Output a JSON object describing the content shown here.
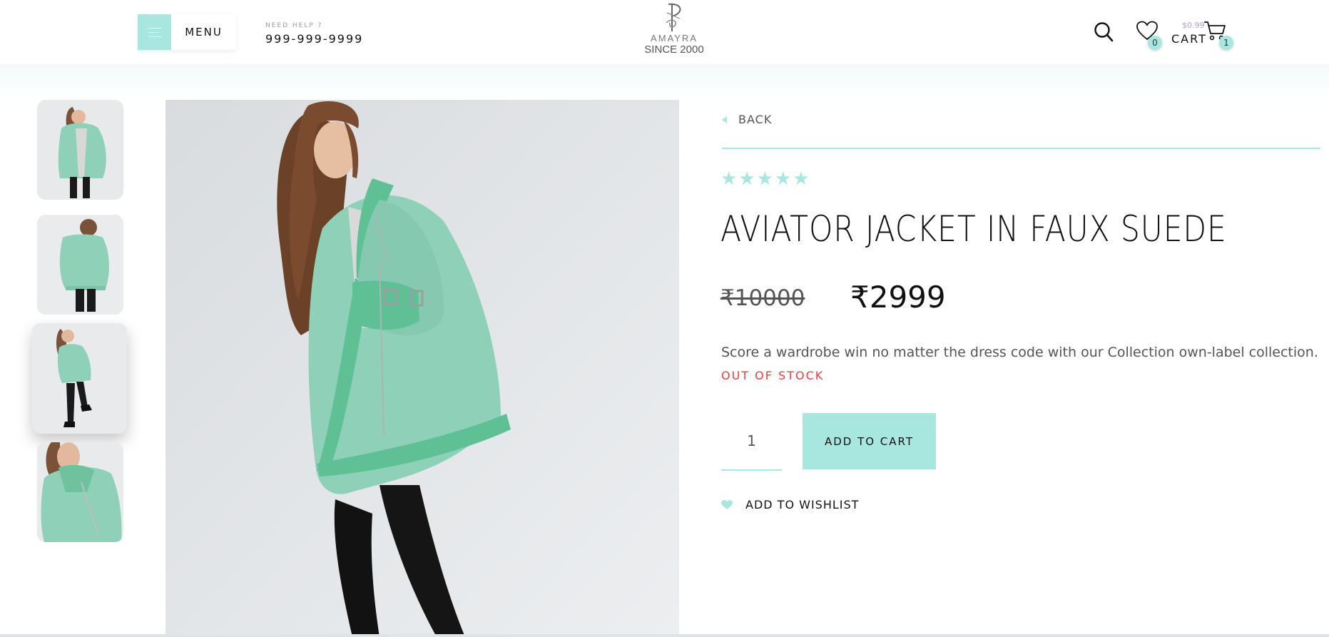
{
  "header": {
    "menu_label": "MENU",
    "help_caption": "NEED HELP ?",
    "help_phone": "999-999-9999",
    "logo": {
      "brand": "AMAYRA",
      "tagline": "SINCE 2000"
    },
    "wishlist_count": "0",
    "cart_total": "$0.99",
    "cart_label": "CART",
    "cart_count": "1",
    "icons": [
      "menu-icon",
      "search-icon",
      "heart-icon",
      "cart-icon"
    ]
  },
  "gallery": {
    "thumbnails": [
      "front view",
      "back view",
      "side full view",
      "collar close-up"
    ],
    "active_index": 2
  },
  "product": {
    "back_label": "BACK",
    "rating": 5,
    "title": "AVIATOR JACKET IN FAUX SUEDE",
    "old_price": "₹10000",
    "new_price": "₹2999",
    "description": "Score a wardrobe win no matter the dress code with our Collection own-label collection.",
    "stock_status": "OUT OF STOCK",
    "quantity": "1",
    "add_to_cart_label": "ADD TO CART",
    "wishlist_label": "ADD TO WISHLIST"
  },
  "colors": {
    "accent": "#a8e7e0",
    "stock_red": "#f03d3d",
    "jacket": "#8fd0b9"
  }
}
